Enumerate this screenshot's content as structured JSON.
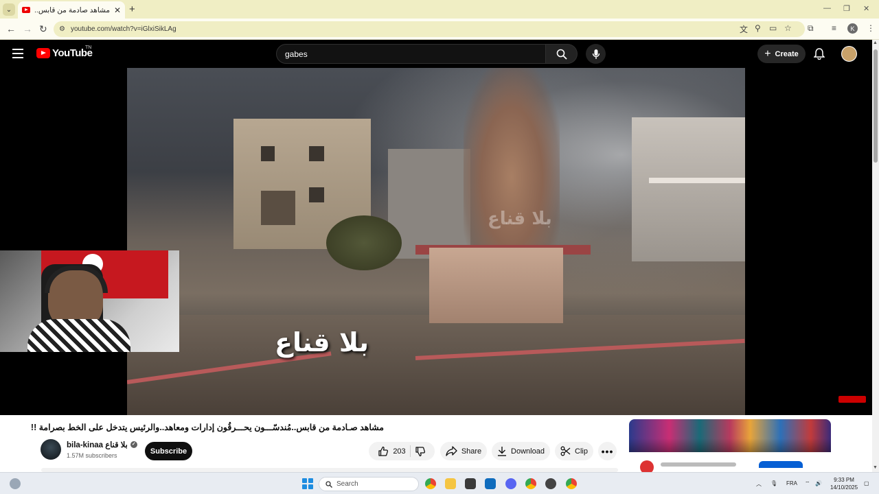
{
  "browser": {
    "tab_title": "مشاهد صادمة من قابس..",
    "tab_close": "✕",
    "new_tab": "+",
    "url": "youtube.com/watch?v=iGlxiSikLAg",
    "profile_initial": "K",
    "win_min": "—",
    "win_max": "❐",
    "win_close": "✕"
  },
  "youtube": {
    "logo_text": "YouTube",
    "country_code": "TN",
    "search_query": "gabes",
    "create_label": "Create"
  },
  "video": {
    "watermark_large": "بلا قناع",
    "watermark_small": "بلا قناع",
    "title": "مشاهد صـادمة من قابس..مُندسّـــون يحـــرقُون إدارات ومعاهد..والرئيس يتدخل على الخط بصرامة !!"
  },
  "channel": {
    "name": "bila-kinaa بلا قناع",
    "subscribers": "1.57M subscribers",
    "subscribe_label": "Subscribe"
  },
  "actions": {
    "like_count": "203",
    "share_label": "Share",
    "download_label": "Download",
    "clip_label": "Clip"
  },
  "taskbar": {
    "search_placeholder": "Search",
    "lang": "FRA",
    "time": "9:33 PM",
    "date": "14/10/2025"
  }
}
